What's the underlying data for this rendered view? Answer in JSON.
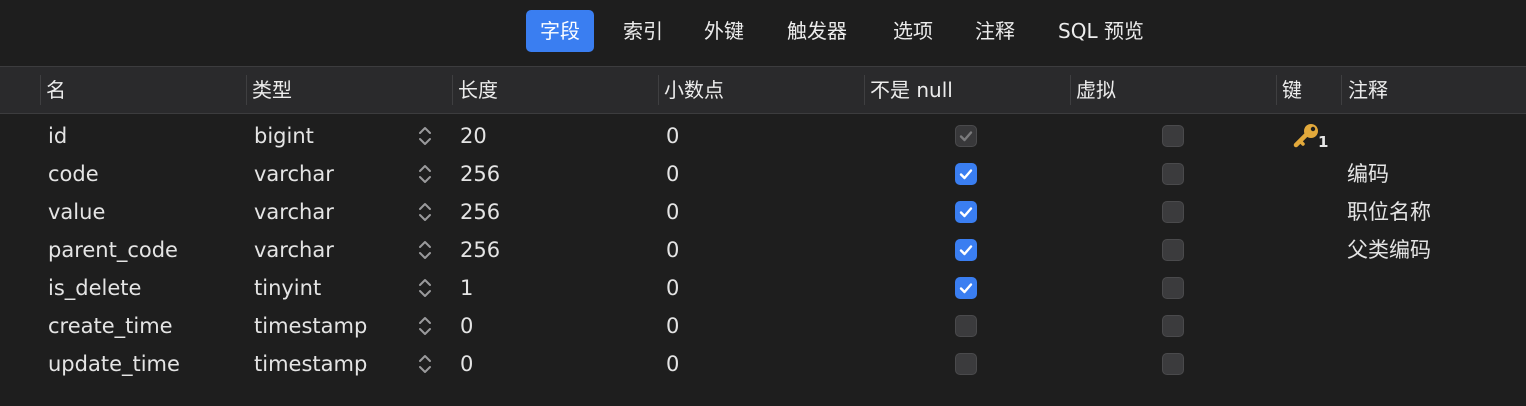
{
  "tabs": [
    {
      "label": "字段",
      "active": true
    },
    {
      "label": "索引",
      "active": false
    },
    {
      "label": "外键",
      "active": false
    },
    {
      "label": "触发器",
      "active": false
    },
    {
      "label": "选项",
      "active": false
    },
    {
      "label": "注释",
      "active": false
    },
    {
      "label": "SQL 预览",
      "active": false
    }
  ],
  "columns": {
    "name": "名",
    "type": "类型",
    "length": "长度",
    "decimals": "小数点",
    "not_null": "不是 null",
    "virtual": "虚拟",
    "key": "键",
    "comment": "注释"
  },
  "rows": [
    {
      "name": "id",
      "type": "bigint",
      "length": "20",
      "decimals": "0",
      "not_null": true,
      "not_null_disabled": true,
      "virtual": false,
      "key": "1",
      "comment": ""
    },
    {
      "name": "code",
      "type": "varchar",
      "length": "256",
      "decimals": "0",
      "not_null": true,
      "not_null_disabled": false,
      "virtual": false,
      "key": "",
      "comment": "编码"
    },
    {
      "name": "value",
      "type": "varchar",
      "length": "256",
      "decimals": "0",
      "not_null": true,
      "not_null_disabled": false,
      "virtual": false,
      "key": "",
      "comment": "职位名称"
    },
    {
      "name": "parent_code",
      "type": "varchar",
      "length": "256",
      "decimals": "0",
      "not_null": true,
      "not_null_disabled": false,
      "virtual": false,
      "key": "",
      "comment": "父类编码"
    },
    {
      "name": "is_delete",
      "type": "tinyint",
      "length": "1",
      "decimals": "0",
      "not_null": true,
      "not_null_disabled": false,
      "virtual": false,
      "key": "",
      "comment": ""
    },
    {
      "name": "create_time",
      "type": "timestamp",
      "length": "0",
      "decimals": "0",
      "not_null": false,
      "not_null_disabled": false,
      "virtual": false,
      "key": "",
      "comment": ""
    },
    {
      "name": "update_time",
      "type": "timestamp",
      "length": "0",
      "decimals": "0",
      "not_null": false,
      "not_null_disabled": false,
      "virtual": false,
      "key": "",
      "comment": ""
    }
  ],
  "icons": {
    "key": "key-icon",
    "stepper": "chevron-up-down-icon",
    "check": "check-icon"
  },
  "colors": {
    "accent": "#3a7ef1",
    "key": "#e2a93b",
    "background": "#1e1e1e"
  }
}
